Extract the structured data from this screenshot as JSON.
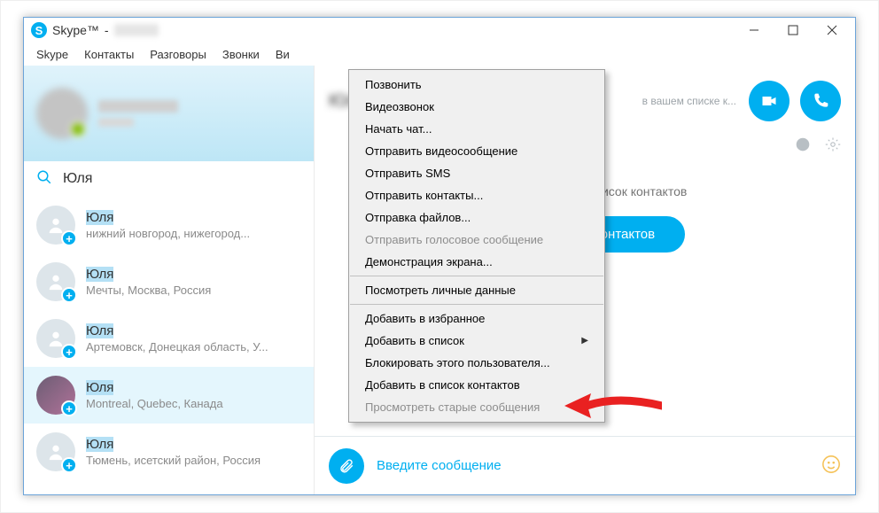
{
  "window": {
    "app_label": "Skype™",
    "sep": "-"
  },
  "menubar": [
    "Skype",
    "Контакты",
    "Разговоры",
    "Звонки",
    "Ви"
  ],
  "search": {
    "value": "Юля"
  },
  "contacts": [
    {
      "name": "Юля",
      "name_highlight": true,
      "location": "нижний новгород, нижегород..."
    },
    {
      "name": "Юля",
      "name_highlight": true,
      "location": "Мечты, Москва, Россия"
    },
    {
      "name": "Юля",
      "name_highlight": true,
      "location": "Артемовск, Донецкая область, У..."
    },
    {
      "name": "Юля",
      "name_highlight": true,
      "location": "Montreal, Quebec, Канада",
      "selected": true,
      "has_photo": true
    },
    {
      "name": "Юля",
      "name_highlight": true,
      "location": "Тюмень, исетский район, Россия"
    }
  ],
  "conversation": {
    "header_name": "Юля",
    "subtitle": "в вашем списке к...",
    "center_text": "не включен в ваш список контактов",
    "add_button": "ить в список контактов"
  },
  "composer": {
    "placeholder": "Введите сообщение"
  },
  "context_menu": [
    {
      "label": "Позвонить"
    },
    {
      "label": "Видеозвонок"
    },
    {
      "label": "Начать чат..."
    },
    {
      "label": "Отправить видеосообщение"
    },
    {
      "label": "Отправить SMS"
    },
    {
      "label": "Отправить контакты..."
    },
    {
      "label": "Отправка файлов..."
    },
    {
      "label": "Отправить голосовое сообщение",
      "disabled": true
    },
    {
      "label": "Демонстрация экрана..."
    },
    {
      "sep": true
    },
    {
      "label": "Посмотреть личные данные"
    },
    {
      "sep": true
    },
    {
      "label": "Добавить в избранное"
    },
    {
      "label": "Добавить в список",
      "submenu": true
    },
    {
      "label": "Блокировать этого пользователя..."
    },
    {
      "label": "Добавить в список контактов"
    },
    {
      "label": "Просмотреть старые сообщения",
      "disabled": true
    }
  ]
}
